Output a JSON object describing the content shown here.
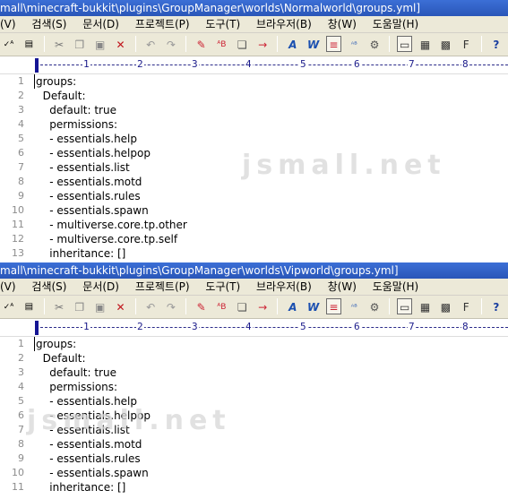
{
  "window1": {
    "title": "mall\\minecraft-bukkit\\plugins\\GroupManager\\worlds\\Normalworld\\groups.yml]",
    "lines": [
      {
        "n": "1",
        "text": "groups:"
      },
      {
        "n": "2",
        "text": "  Default:"
      },
      {
        "n": "3",
        "text": "    default: true"
      },
      {
        "n": "4",
        "text": "    permissions:"
      },
      {
        "n": "5",
        "text": "    - essentials.help"
      },
      {
        "n": "6",
        "text": "    - essentials.helpop"
      },
      {
        "n": "7",
        "text": "    - essentials.list"
      },
      {
        "n": "8",
        "text": "    - essentials.motd"
      },
      {
        "n": "9",
        "text": "    - essentials.rules"
      },
      {
        "n": "10",
        "text": "    - essentials.spawn"
      },
      {
        "n": "11",
        "text": "    - multiverse.core.tp.other"
      },
      {
        "n": "12",
        "text": "    - multiverse.core.tp.self"
      },
      {
        "n": "13",
        "text": "    inheritance: []"
      }
    ],
    "watermark": "jsmall.net"
  },
  "window2": {
    "title": "mall\\minecraft-bukkit\\plugins\\GroupManager\\worlds\\Vipworld\\groups.yml]",
    "lines": [
      {
        "n": "1",
        "text": "groups:"
      },
      {
        "n": "2",
        "text": "  Default:"
      },
      {
        "n": "3",
        "text": "    default: true"
      },
      {
        "n": "4",
        "text": "    permissions:"
      },
      {
        "n": "5",
        "text": "    - essentials.help"
      },
      {
        "n": "6",
        "text": "    - essentials.helpop"
      },
      {
        "n": "7",
        "text": "    - essentials.list"
      },
      {
        "n": "8",
        "text": "    - essentials.motd"
      },
      {
        "n": "9",
        "text": "    - essentials.rules"
      },
      {
        "n": "10",
        "text": "    - essentials.spawn"
      },
      {
        "n": "11",
        "text": "    inheritance: []"
      }
    ],
    "watermark": "jsmall.net"
  },
  "menu": [
    "(V)",
    "검색(S)",
    "문서(D)",
    "프로젝트(P)",
    "도구(T)",
    "브라우저(B)",
    "창(W)",
    "도움말(H)"
  ],
  "ruler": {
    "numbers": [
      "1",
      "2",
      "3",
      "4",
      "5",
      "6",
      "7",
      "8"
    ]
  },
  "toolbar_icons": [
    "spellcheck-icon",
    "text-mode-icon",
    "cut-icon",
    "copy-icon",
    "paste-icon",
    "delete-icon",
    "undo-icon",
    "redo-icon",
    "find-icon",
    "replace-icon",
    "find-in-files-icon",
    "jump-icon",
    "font-icon",
    "web-icon",
    "word-wrap-icon",
    "wrap-columns-icon",
    "settings-icon",
    "window-icon",
    "outline-icon",
    "macro-icon",
    "function-icon",
    "help-icon"
  ],
  "colors": {
    "titlebar": "#2f5fc4",
    "ruler_accent": "#151594",
    "line_number": "#8c8c8c"
  }
}
